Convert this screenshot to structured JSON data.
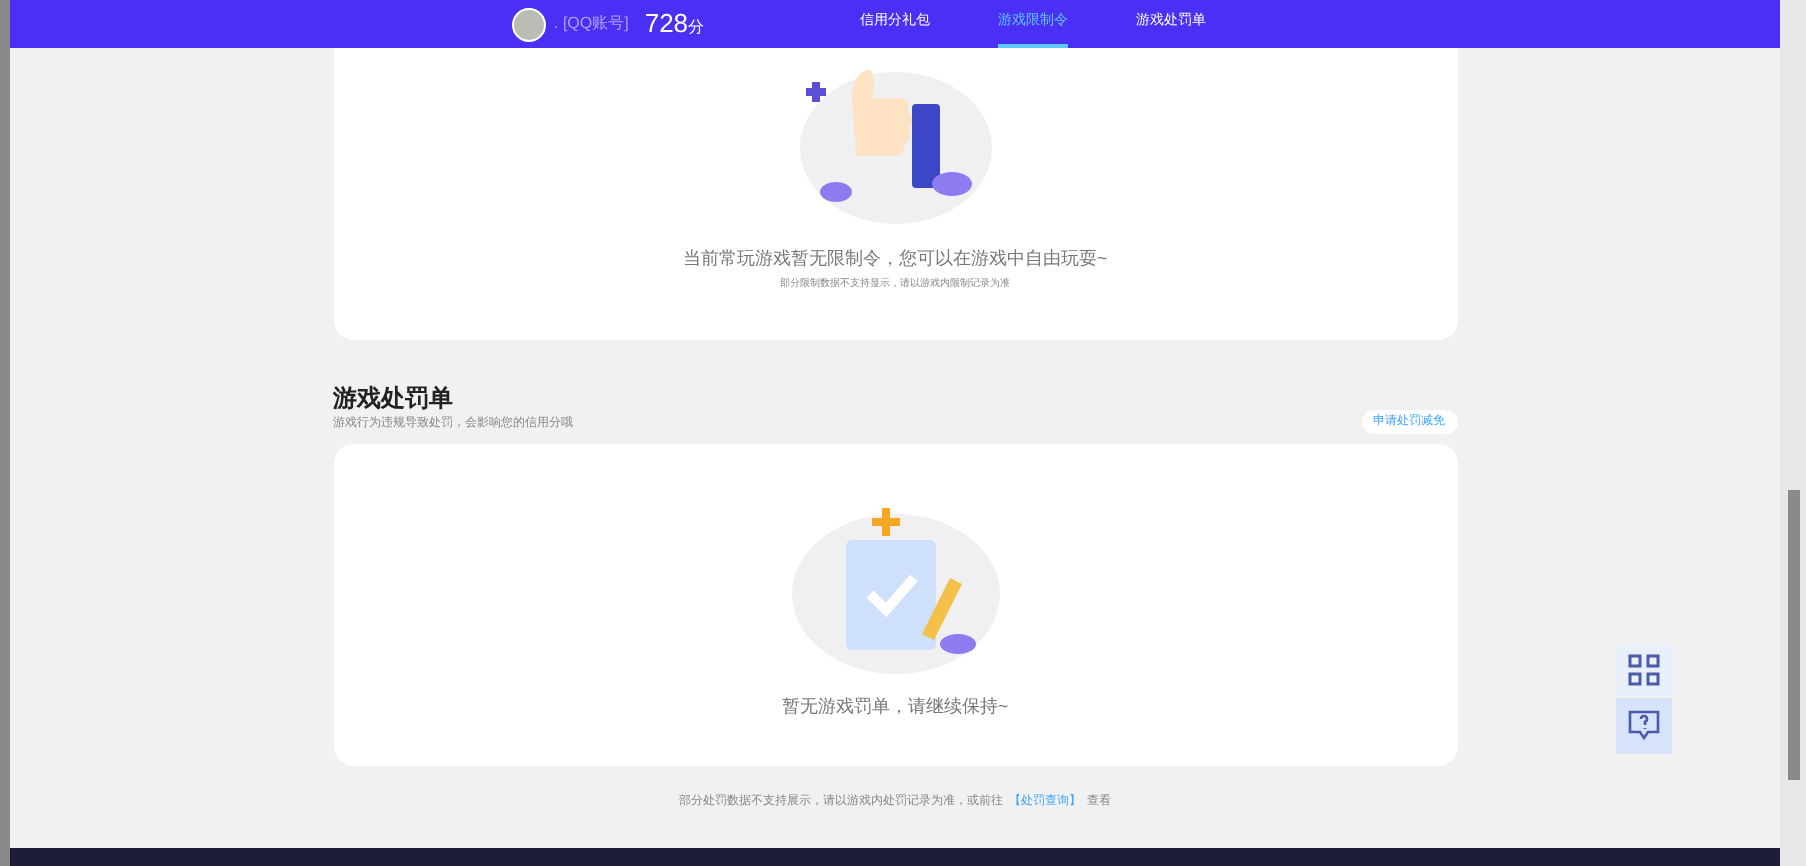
{
  "header": {
    "nickname": ". [QQ账号]",
    "score": "728",
    "score_unit": "分",
    "tabs": [
      {
        "label": "信用分礼包",
        "selected": false
      },
      {
        "label": "游戏限制令",
        "selected": true
      },
      {
        "label": "游戏处罚单",
        "selected": false
      }
    ]
  },
  "restriction_card": {
    "message": "当前常玩游戏暂无限制令，您可以在游戏中自由玩耍~",
    "note": "部分限制数据不支持显示，请以游戏内限制记录为准"
  },
  "penalty_section": {
    "title": "游戏处罚单",
    "subtitle": "游戏行为违规导致处罚，会影响您的信用分哦",
    "action": "申请处罚减免",
    "message": "暂无游戏罚单，请继续保持~"
  },
  "footer": {
    "text": "部分处罚数据不支持展示，请以游戏内处罚记录为准，或前往",
    "link": "【处罚查询】",
    "after": "查看"
  }
}
